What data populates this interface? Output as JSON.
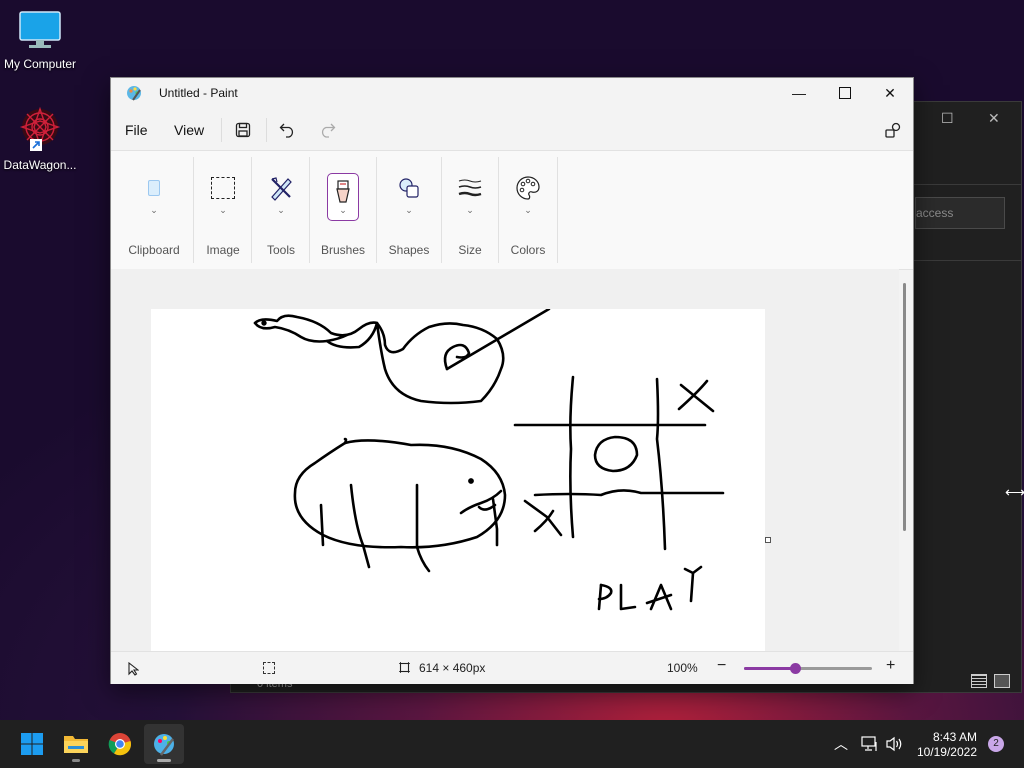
{
  "desktop": {
    "icons": [
      {
        "label": "My Computer",
        "icon": "monitor-icon"
      },
      {
        "label": "DataWagon...",
        "icon": "datawagon-app-icon"
      }
    ]
  },
  "background_window": {
    "search_placeholder": "access",
    "status_text": "0 items"
  },
  "paint": {
    "title": "Untitled - Paint",
    "menu": {
      "file": "File",
      "view": "View"
    },
    "ribbon_groups": [
      "Clipboard",
      "Image",
      "Tools",
      "Brushes",
      "Shapes",
      "Size",
      "Colors"
    ],
    "canvas_size": "614 × 460px",
    "zoom": "100%",
    "zoom_level_fraction": 0.4,
    "accent_color": "#8b3aa3"
  },
  "taskbar": {
    "apps": [
      "start-icon",
      "file-explorer-icon",
      "chrome-icon",
      "paint-icon"
    ],
    "time": "8:43 AM",
    "date": "10/19/2022",
    "notification_count": "2"
  }
}
